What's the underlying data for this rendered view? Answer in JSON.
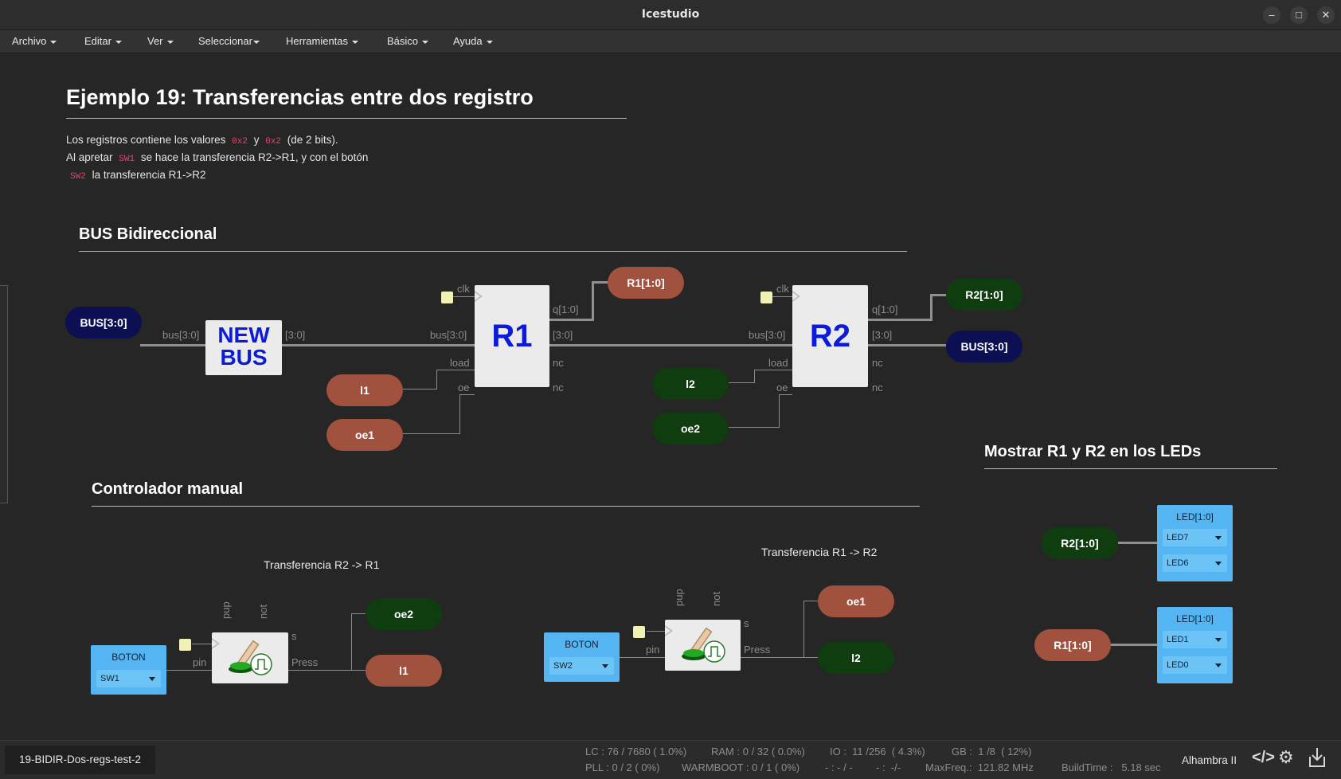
{
  "window": {
    "title": "Icestudio",
    "minimize": "–",
    "maximize": "□",
    "close": "✕"
  },
  "menu": [
    "Archivo",
    "Editar",
    "Ver",
    "Seleccionar",
    "Herramientas",
    "Básico",
    "Ayuda"
  ],
  "doc": {
    "title": "Ejemplo 19: Transferencias entre dos registro",
    "line1_a": "Los registros contiene los valores",
    "code1": "0x2",
    "y": "y",
    "code2": "0x2",
    "line1_b": "(de 2 bits).",
    "line2_a": "Al apretar",
    "code3": "SW1",
    "line2_b": "se hace la transferencia R2->R1, y con el botón",
    "code4": "SW2",
    "line3": "la transferencia R1->R2"
  },
  "sections": {
    "bus": "BUS Bidireccional",
    "controller": "Controlador manual",
    "leds": "Mostrar R1 y R2 en los LEDs"
  },
  "bus_diagram": {
    "bus_left": "BUS[3:0]",
    "bus_right": "BUS[3:0]",
    "newbus_line1": "NEW",
    "newbus_line2": "BUS",
    "port_bus": "bus[3:0]",
    "port_bus_r1": "bus[3:0]",
    "port_bus_r2": "bus[3:0]",
    "port_out": "[3:0]",
    "r1_label": "R1",
    "r2_label": "R2",
    "clk": "clk",
    "load": "load",
    "oe": "oe",
    "q": "q[1:0]",
    "bus_out": "[3:0]",
    "nc": "nc",
    "r1_out": "R1[1:0]",
    "r2_out": "R2[1:0]",
    "l1": "l1",
    "oe1": "oe1",
    "l2": "l2",
    "oe2": "oe2"
  },
  "controller": {
    "label_a": "Transferencia R2 -> R1",
    "label_b": "Transferencia R1 -> R2",
    "boton": "BOTON",
    "sw1": "SW1",
    "sw2": "SW2",
    "pin": "pin",
    "pup": "pup",
    "not": "not",
    "s": "s",
    "press": "Press",
    "out_a1": "oe2",
    "out_a2": "l1",
    "out_b1": "oe1",
    "out_b2": "l2"
  },
  "leds": {
    "r2": "R2[1:0]",
    "r1": "R1[1:0]",
    "block_title": "LED[1:0]",
    "led7": "LED7",
    "led6": "LED6",
    "led1": "LED1",
    "led0": "LED0"
  },
  "status": {
    "project": "19-BIDIR-Dos-regs-test-2",
    "lc": "LC : 76 / 7680 ( 1.0%)",
    "ram": "RAM : 0 / 32 ( 0.0%)",
    "io": "IO :  11 /256  ( 4.3%)",
    "gb": "GB :  1 /8  ( 12%)",
    "pll": "PLL : 0 / 2 ( 0%)",
    "warmboot": "WARMBOOT : 0 / 1 ( 0%)",
    "dashes1": "- : - / -",
    "dashes2": "- :  -/-",
    "maxfreq": "MaxFreq.:  121.82 MHz",
    "buildtime": "BuildTime :   5.18 sec",
    "board": "Alhambra II"
  },
  "colors": {
    "navy": "#0c0f52",
    "brown": "#a0523f",
    "green": "#0f3d10",
    "reg_text": "#0b1bd8",
    "io_blue": "#55b4f2"
  }
}
